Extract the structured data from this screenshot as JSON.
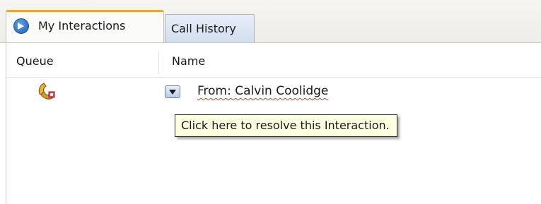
{
  "tabs": [
    {
      "label": "My Interactions",
      "icon": "arrow-right-circle-icon",
      "active": true
    },
    {
      "label": "Call History",
      "active": false
    }
  ],
  "columns": {
    "queue": "Queue",
    "name": "Name"
  },
  "rows": [
    {
      "queue_icon": "phone-handset-icon",
      "name": "From: Calvin Coolidge"
    }
  ],
  "tooltip": "Click here to resolve this Interaction.",
  "colors": {
    "active_tab_accent": "#f2a23a",
    "tooltip_bg": "#ffffe1",
    "spellcheck_underline": "#d63b3b"
  }
}
